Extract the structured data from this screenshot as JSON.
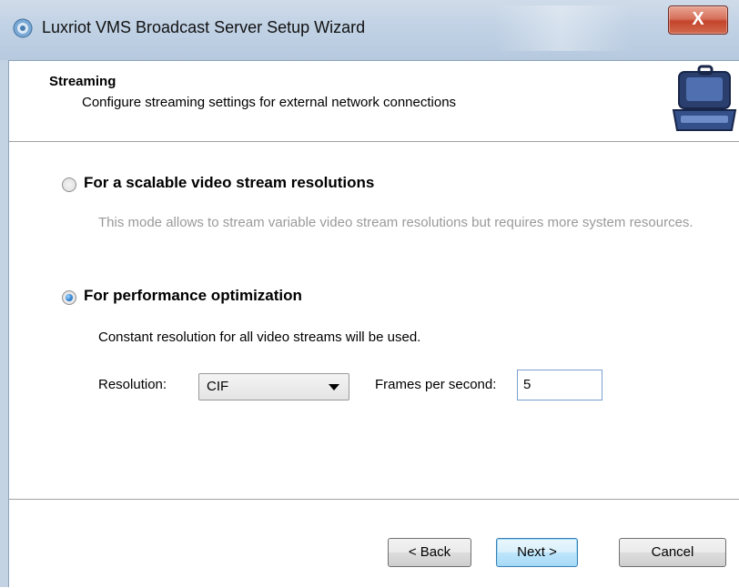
{
  "window": {
    "title": "Luxriot VMS Broadcast Server Setup Wizard",
    "close_label": "X"
  },
  "header": {
    "title": "Streaming",
    "subtitle": "Configure streaming settings for external network connections",
    "icon": "laptop-case-icon"
  },
  "options": {
    "scalable": {
      "label": "For a scalable video stream resolutions",
      "checked": false,
      "description": "This mode allows to stream variable video stream resolutions but requires more system resources."
    },
    "performance": {
      "label": "For performance optimization",
      "checked": true,
      "description": "Constant resolution for all video streams will be used."
    }
  },
  "settings": {
    "resolution_label": "Resolution:",
    "resolution_value": "CIF",
    "fps_label": "Frames per second:",
    "fps_value": "5"
  },
  "buttons": {
    "back": "< Back",
    "next": "Next >",
    "cancel": "Cancel"
  },
  "colors": {
    "titlebar": "#c1d2e5",
    "close_button": "#c4442c",
    "default_button": "#3c7fb1",
    "disabled_text": "#9a9a9a"
  }
}
